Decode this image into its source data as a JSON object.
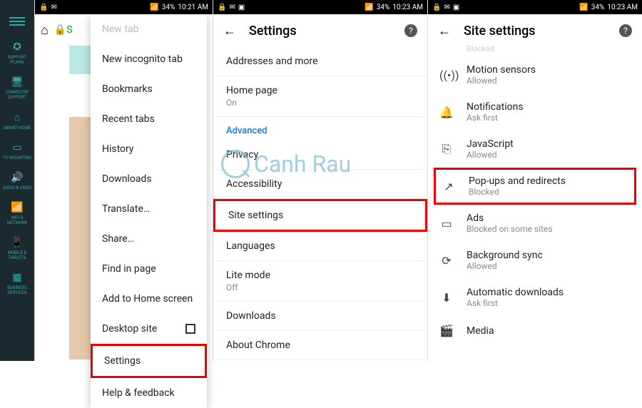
{
  "status": {
    "left_icons": [
      "lock",
      "mail",
      "img"
    ],
    "signal": "📶",
    "battery": "34%",
    "time1": "10:21 AM",
    "time2": "10:23 AM",
    "time3": "10:23 AM"
  },
  "sidebar": {
    "items": [
      {
        "label": "SUPPORT PLANS",
        "icon": "✪"
      },
      {
        "label": "COMPUTER SUPPORT",
        "icon": "🖥"
      },
      {
        "label": "SMART HOME",
        "icon": "⌂"
      },
      {
        "label": "TV MOUNTING",
        "icon": "▭"
      },
      {
        "label": "AUDIO & VIDEO",
        "icon": "🔊"
      },
      {
        "label": "WIFI & NETWORK",
        "icon": "📶"
      },
      {
        "label": "MOBILE & TABLETS",
        "icon": "📱"
      },
      {
        "label": "BUSINESS SERVICES",
        "icon": "▦"
      }
    ]
  },
  "pane1": {
    "menu": [
      {
        "label": "New tab",
        "faded": true
      },
      {
        "label": "New incognito tab"
      },
      {
        "label": "Bookmarks"
      },
      {
        "label": "Recent tabs"
      },
      {
        "label": "History"
      },
      {
        "label": "Downloads"
      },
      {
        "label": "Translate…"
      },
      {
        "label": "Share…"
      },
      {
        "label": "Find in page"
      },
      {
        "label": "Add to Home screen"
      },
      {
        "label": "Desktop site",
        "checkbox": true
      },
      {
        "label": "Settings",
        "highlight": true
      },
      {
        "label": "Help & feedback"
      }
    ]
  },
  "pane2": {
    "title": "Settings",
    "rows_top": [
      {
        "primary": "Addresses and more"
      },
      {
        "primary": "Home page",
        "secondary": "On"
      }
    ],
    "section": "Advanced",
    "rows_bottom": [
      {
        "primary": "Privacy"
      },
      {
        "primary": "Accessibility"
      },
      {
        "primary": "Site settings",
        "highlight": true
      },
      {
        "primary": "Languages"
      },
      {
        "primary": "Lite mode",
        "secondary": "Off"
      },
      {
        "primary": "Downloads"
      },
      {
        "primary": "About Chrome"
      }
    ]
  },
  "pane3": {
    "title": "Site settings",
    "blocked_label": "Blocked",
    "rows": [
      {
        "icon": "((•))",
        "primary": "Motion sensors",
        "secondary": "Allowed"
      },
      {
        "icon": "🔔",
        "primary": "Notifications",
        "secondary": "Ask first"
      },
      {
        "icon": "⎘",
        "primary": "JavaScript",
        "secondary": "Allowed"
      },
      {
        "icon": "↗",
        "primary": "Pop-ups and redirects",
        "secondary": "Blocked",
        "highlight": true
      },
      {
        "icon": "▭",
        "primary": "Ads",
        "secondary": "Blocked on some sites"
      },
      {
        "icon": "⟳",
        "primary": "Background sync",
        "secondary": "Allowed"
      },
      {
        "icon": "⬇",
        "primary": "Automatic downloads",
        "secondary": "Ask first"
      },
      {
        "icon": "🎬",
        "primary": "Media",
        "secondary": ""
      }
    ]
  },
  "watermark": "Canh Rau"
}
